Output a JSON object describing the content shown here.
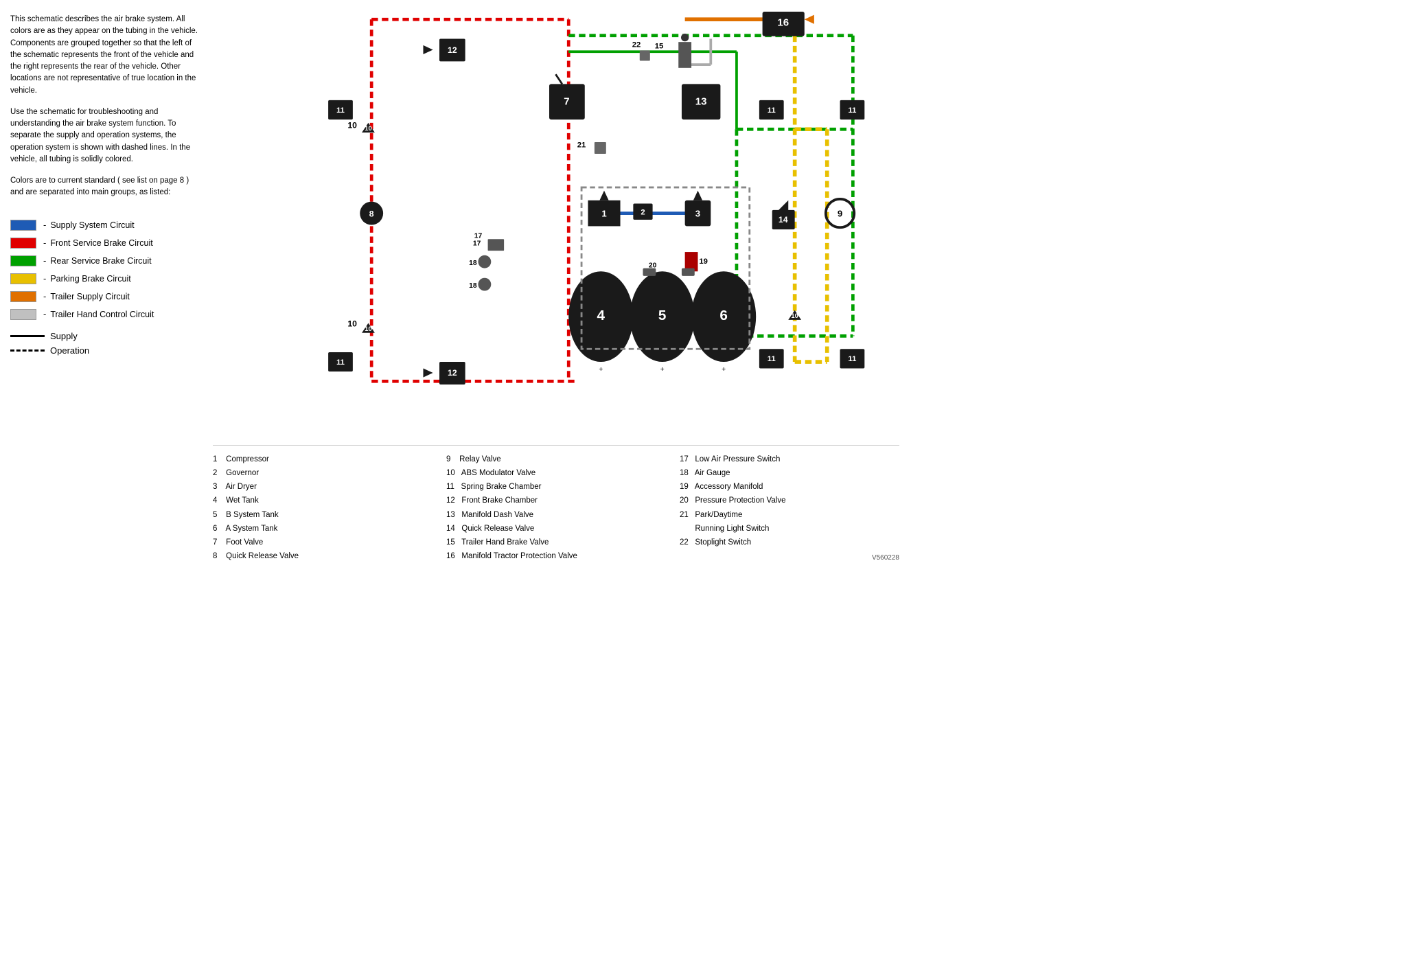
{
  "description": {
    "para1": "This schematic describes the air brake system. All colors are as they appear on the tubing in the vehicle. Components are grouped together so that the left of the schematic represents the front of the vehicle and the right represents the rear of the vehicle. Other locations are not representative of true location in the vehicle.",
    "para2": "Use the schematic for troubleshooting and understanding the air brake system function. To separate the supply and operation systems, the operation system is shown with dashed lines. In the vehicle, all tubing is solidly colored.",
    "para3": "Colors are to current standard ( see list on page 8 ) and are separated into main groups, as listed:"
  },
  "legend": {
    "items": [
      {
        "color": "#1e5bb5",
        "label": "Supply System Circuit"
      },
      {
        "color": "#e00000",
        "label": "Front Service Brake Circuit"
      },
      {
        "color": "#00a000",
        "label": "Rear Service Brake Circuit"
      },
      {
        "color": "#e8c000",
        "label": "Parking Brake Circuit"
      },
      {
        "color": "#e07000",
        "label": "Trailer Supply Circuit"
      },
      {
        "color": "#c0c0c0",
        "label": "Trailer Hand Control Circuit"
      }
    ],
    "lines": [
      {
        "type": "solid",
        "label": "Supply"
      },
      {
        "type": "dashed",
        "label": "Operation"
      }
    ]
  },
  "components": {
    "col1": [
      "1   Compressor",
      "2   Governor",
      "3   Air Dryer",
      "4   Wet Tank",
      "5   B System Tank",
      "6   A System Tank",
      "7   Foot Valve",
      "8   Quick Release Valve"
    ],
    "col2": [
      "9   Relay Valve",
      "10  ABS Modulator Valve",
      "11  Spring Brake Chamber",
      "12  Front Brake Chamber",
      "13  Manifold Dash Valve",
      "14  Quick Release Valve",
      "15  Trailer Hand Brake Valve",
      "16  Manifold Tractor Protection Valve"
    ],
    "col3": [
      "17  Low Air Pressure Switch",
      "18  Air Gauge",
      "19  Accessory Manifold",
      "20  Pressure Protection Valve",
      "21  Park/Daytime",
      "     Running Light Switch",
      "22  Stoplight Switch"
    ]
  },
  "version": "V560228"
}
